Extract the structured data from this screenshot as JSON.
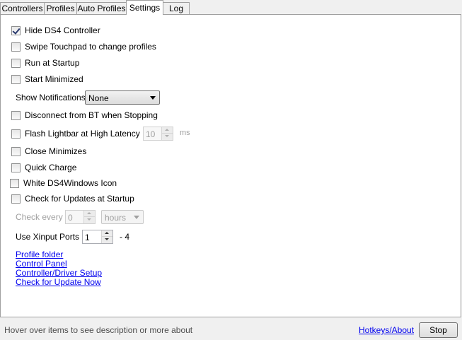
{
  "tabs": [
    "Controllers",
    "Profiles",
    "Auto Profiles",
    "Settings",
    "Log"
  ],
  "active_tab": "Settings",
  "settings": {
    "hide_ds4": {
      "label": "Hide DS4 Controller",
      "checked": true
    },
    "swipe_touchpad": {
      "label": "Swipe Touchpad to change profiles",
      "checked": false
    },
    "run_at_startup": {
      "label": "Run at Startup",
      "checked": false
    },
    "start_minimized": {
      "label": "Start Minimized",
      "checked": false
    },
    "show_notifications": {
      "label": "Show Notifications",
      "value": "None"
    },
    "disconnect_bt": {
      "label": "Disconnect from BT when Stopping",
      "checked": false
    },
    "flash_lightbar": {
      "label": "Flash Lightbar at High Latency",
      "checked": false,
      "value": "10",
      "unit": "ms"
    },
    "close_minimizes": {
      "label": "Close Minimizes",
      "checked": false
    },
    "quick_charge": {
      "label": "Quick Charge",
      "checked": false
    },
    "white_icon": {
      "label": "White DS4Windows Icon",
      "checked": false
    },
    "check_updates": {
      "label": "Check for Updates at Startup",
      "checked": false
    },
    "check_every": {
      "label": "Check every",
      "value": "0",
      "unit": "hours"
    },
    "xinput": {
      "label": "Use Xinput Ports",
      "value": "1",
      "suffix": "- 4"
    }
  },
  "links": {
    "profile_folder": "Profile folder",
    "control_panel": "Control Panel",
    "driver_setup": "Controller/Driver Setup",
    "check_update_now": "Check for Update Now"
  },
  "statusbar": {
    "hint": "Hover over items to see description or more about",
    "hotkeys": "Hotkeys/About",
    "stop": "Stop"
  }
}
